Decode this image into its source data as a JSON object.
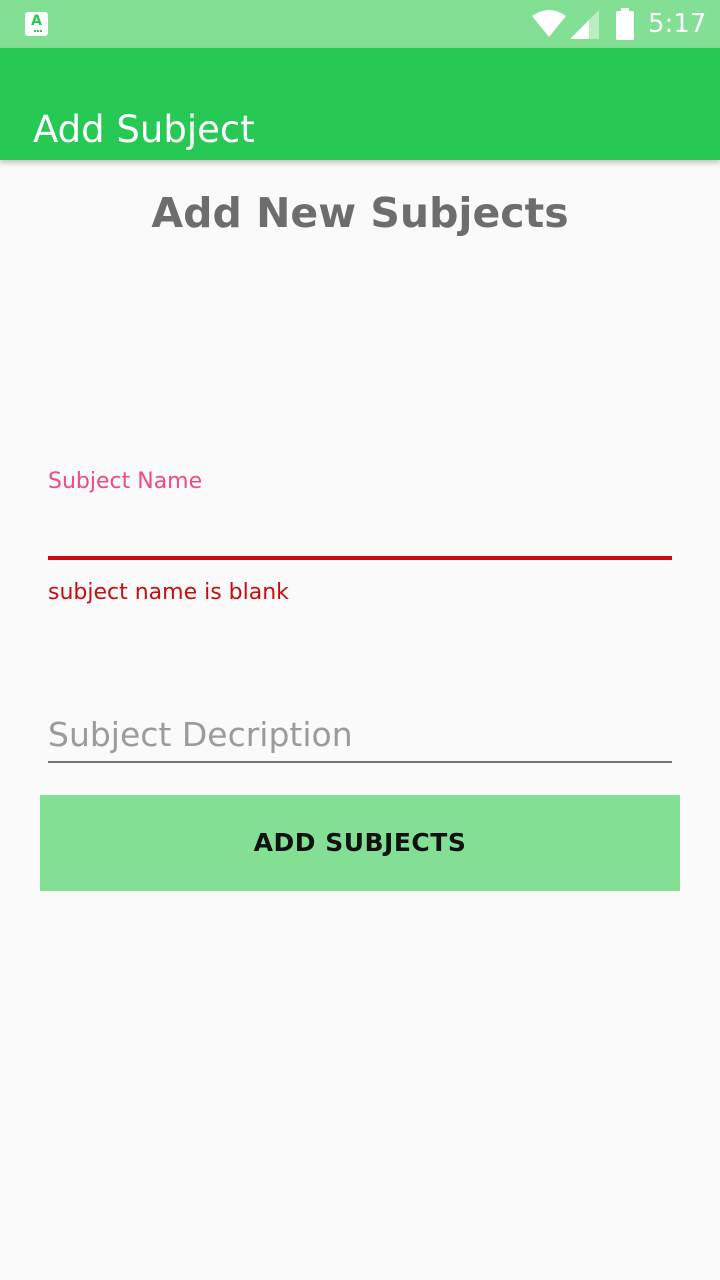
{
  "status_bar": {
    "time": "5:17",
    "app_icon_letter": "A",
    "icons": [
      "app-notification-icon",
      "wifi-icon",
      "cell-signal-icon",
      "battery-icon"
    ],
    "background_color": "#83df94"
  },
  "app_bar": {
    "title": "Add Subject",
    "background_color": "#26c954"
  },
  "page": {
    "heading": "Add New Subjects"
  },
  "form": {
    "subject_name": {
      "label": "Subject Name",
      "value": "",
      "error": "subject name is blank",
      "label_color": "#ef4a83",
      "error_color": "#c70e0e"
    },
    "subject_description": {
      "placeholder": "Subject Decription",
      "value": ""
    },
    "submit_label": "ADD SUBJECTS",
    "submit_color": "#83df94"
  }
}
